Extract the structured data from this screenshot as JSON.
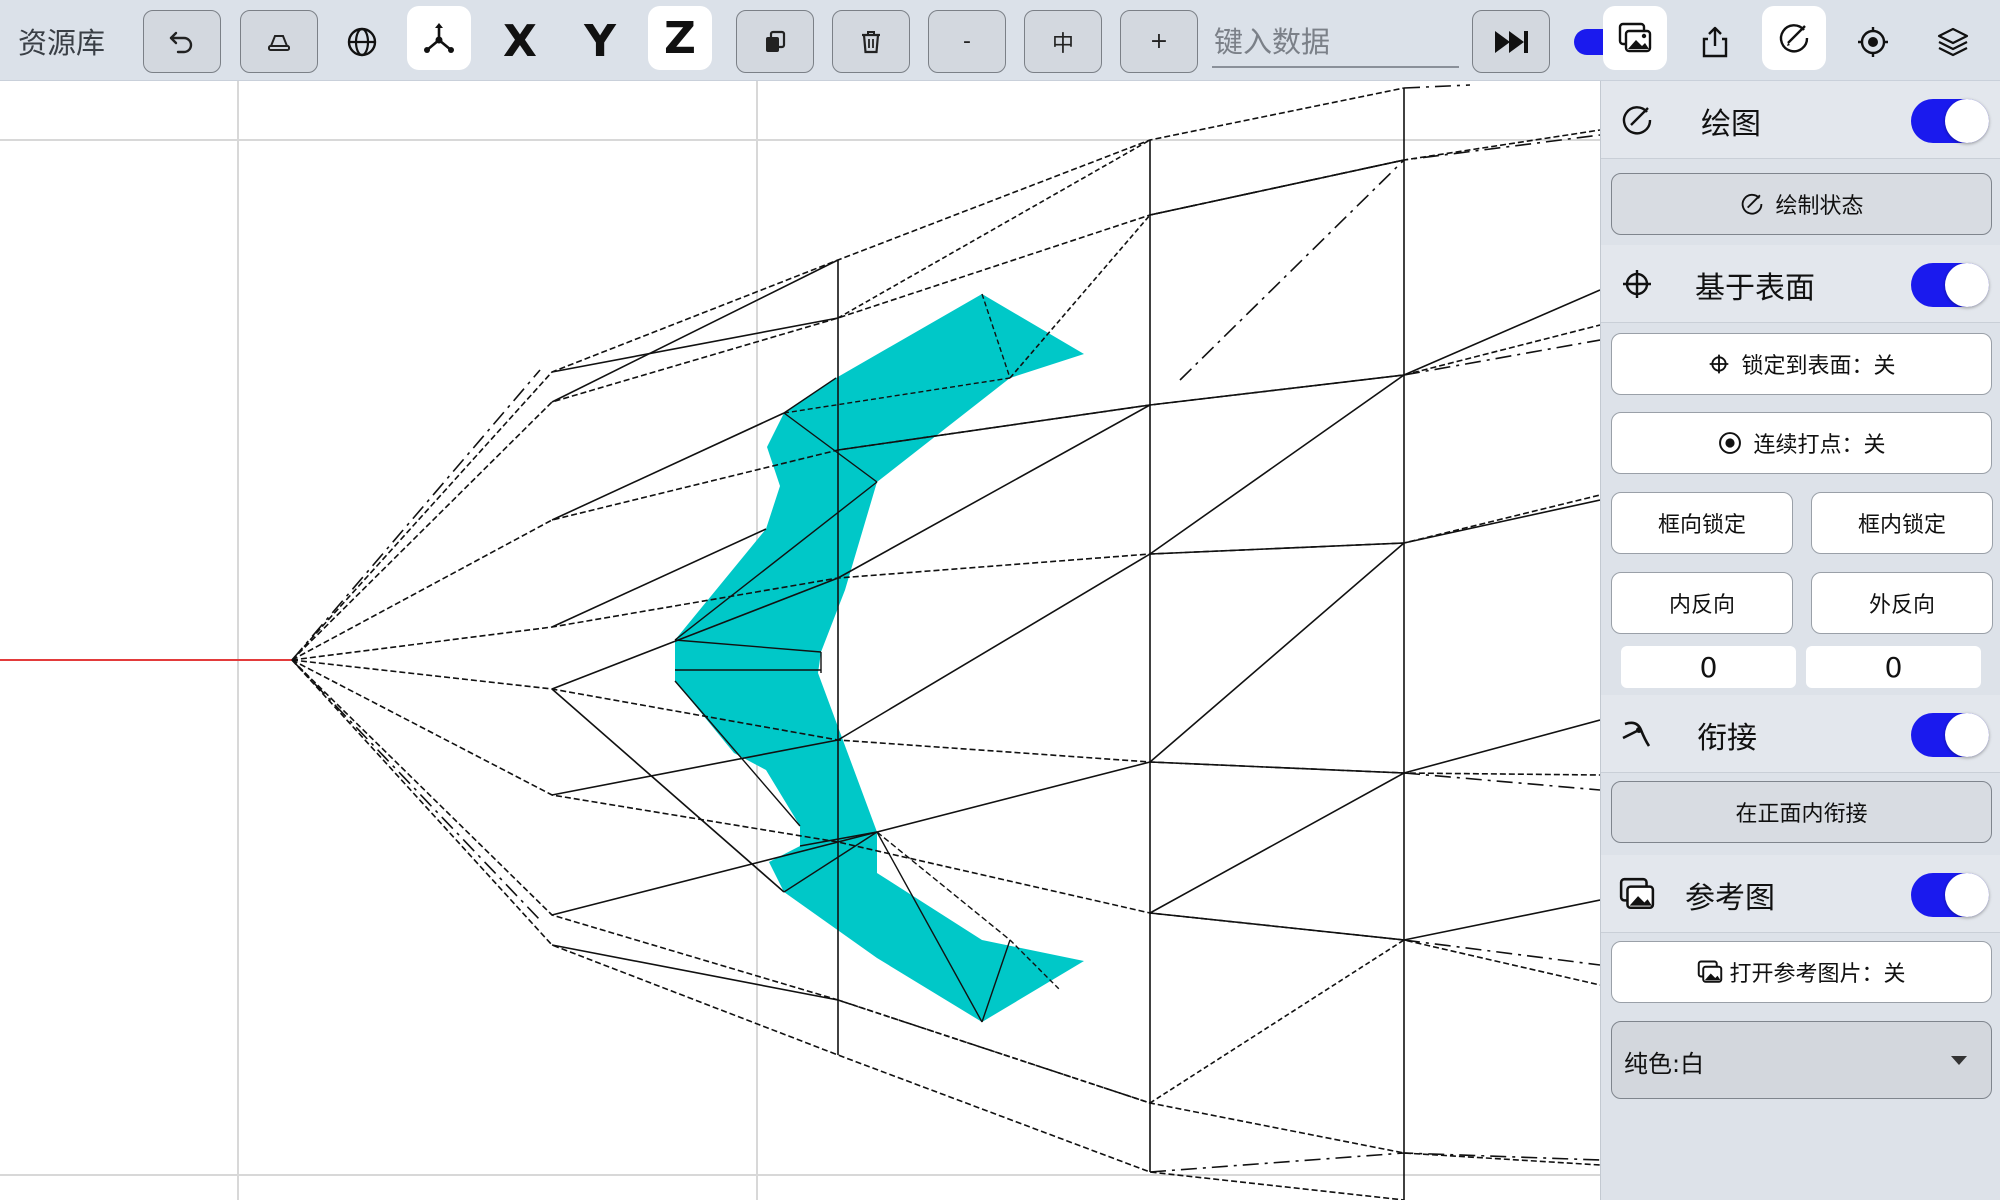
{
  "toolbar": {
    "library_label": "资源库",
    "axis_x": "X",
    "axis_y": "Y",
    "axis_z": "Z",
    "zoom_minus": "-",
    "zoom_mid": "中",
    "zoom_plus": "+",
    "data_input_placeholder": "键入数据",
    "icons": [
      "undo-icon",
      "eraser-icon",
      "globe-icon",
      "axes-gizmo-icon",
      "duplicate-icon",
      "trash-icon",
      "fast-forward-icon",
      "reference-image-icon",
      "export-icon",
      "draw-icon",
      "target-icon",
      "layers-icon"
    ]
  },
  "panel": {
    "draw": {
      "title": "绘图",
      "toggle_on": true,
      "draw_state_label": "绘制状态"
    },
    "surface": {
      "title": "基于表面",
      "toggle_on": true,
      "lock_to_surface_label": "锁定到表面：关",
      "continuous_points_label": "连续打点：关",
      "frame_dir_lock_label": "框向锁定",
      "frame_in_lock_label": "框内锁定",
      "inner_reverse_label": "内反向",
      "outer_reverse_label": "外反向",
      "value_left": "0",
      "value_right": "0"
    },
    "join": {
      "title": "衔接",
      "toggle_on": true,
      "join_front_label": "在正面内衔接"
    },
    "reference": {
      "title": "参考图",
      "toggle_on": true,
      "open_ref_label": "打开参考图片：关",
      "color_select_value": "纯色:白"
    }
  },
  "colors": {
    "toolbar_bg": "#dbe1e9",
    "panel_bg": "#dde2e9",
    "toggle_on": "#1a1aee",
    "shape_fill": "#00c8c8",
    "x_axis_line": "#e33b3b",
    "grid_line": "#d8d8d8"
  }
}
